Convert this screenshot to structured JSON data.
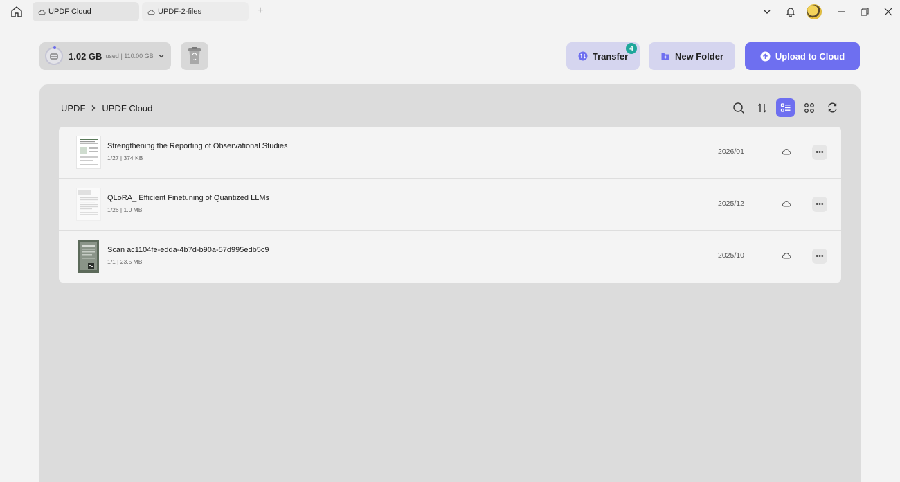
{
  "tabs": [
    {
      "label": "UPDF Cloud",
      "active": true
    },
    {
      "label": "UPDF-2-files",
      "active": false
    }
  ],
  "storage": {
    "used": "1.02 GB",
    "detail": "used | 110.00 GB"
  },
  "actions": {
    "transfer_label": "Transfer",
    "transfer_count": "4",
    "new_folder_label": "New Folder",
    "upload_label": "Upload to Cloud"
  },
  "breadcrumb": {
    "root": "UPDF",
    "current": "UPDF Cloud"
  },
  "files": [
    {
      "name": "Strengthening the Reporting of Observational Studies",
      "meta": "1/27 | 374 KB",
      "date": "2026/01",
      "thumb": "document"
    },
    {
      "name": "QLoRA_ Efficient Finetuning of Quantized LLMs",
      "meta": "1/26 | 1.0 MB",
      "date": "2025/12",
      "thumb": "document-faded"
    },
    {
      "name": "Scan ac1104fe-edda-4b7d-b90a-57d995edb5c9",
      "meta": "1/1 | 23.5 MB",
      "date": "2025/10",
      "thumb": "scan"
    }
  ],
  "colors": {
    "accent": "#6e6ff0",
    "accent_soft": "#d5d5ef",
    "badge": "#1fa79a"
  }
}
